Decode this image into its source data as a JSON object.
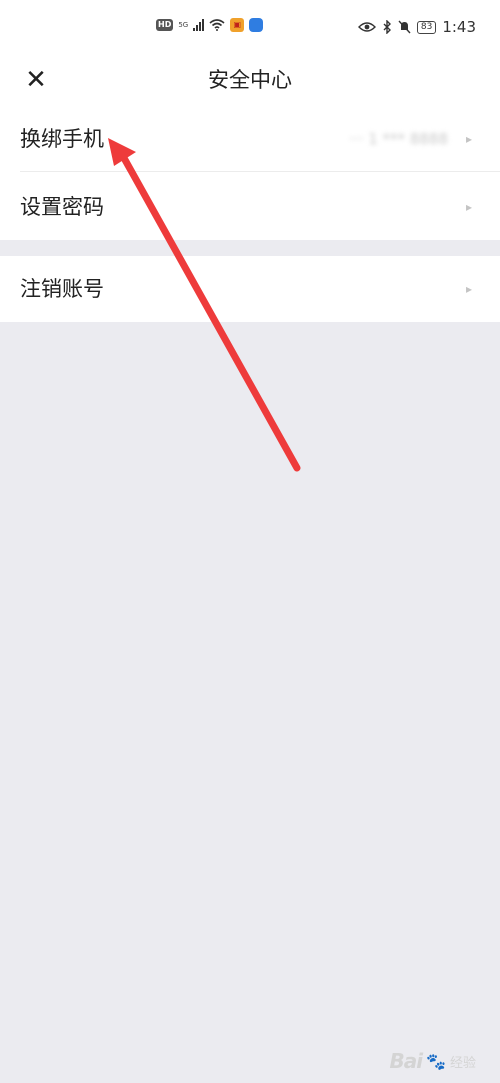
{
  "status_bar": {
    "hd": "HD",
    "network": "5G",
    "battery": "83",
    "time": "1:43",
    "icons": [
      "hd-icon",
      "signal-icon",
      "wifi-icon",
      "app-notification-icon",
      "cloud-icon",
      "eye-icon",
      "bluetooth-icon",
      "mute-icon",
      "battery-icon"
    ]
  },
  "header": {
    "close_icon": "✕",
    "title": "安全中心"
  },
  "menu": {
    "rebind_phone": {
      "label": "换绑手机",
      "value": "··· 1 *** 8888"
    },
    "set_password": {
      "label": "设置密码"
    },
    "delete_account": {
      "label": "注销账号"
    },
    "chevron": "▸"
  },
  "annotation": {
    "arrow_color": "#ee3b3b"
  },
  "watermark": {
    "logo": "Bai",
    "paw": "🐾",
    "text": "经验"
  }
}
